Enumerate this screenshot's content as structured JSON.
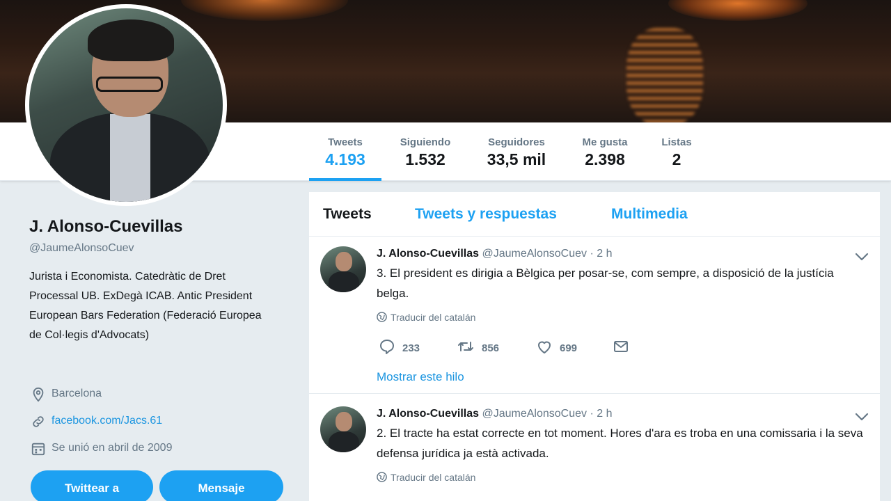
{
  "colors": {
    "accent": "#1da1f2",
    "link": "#1b95e0",
    "text": "#14171a",
    "muted": "#657786",
    "background": "#e6ecf0"
  },
  "stats": [
    {
      "label": "Tweets",
      "value": "4.193"
    },
    {
      "label": "Siguiendo",
      "value": "1.532"
    },
    {
      "label": "Seguidores",
      "value": "33,5 mil"
    },
    {
      "label": "Me gusta",
      "value": "2.398"
    },
    {
      "label": "Listas",
      "value": "2"
    }
  ],
  "profile": {
    "name": "J. Alonso-Cuevillas",
    "handle": "@JaumeAlonsoCuev",
    "bio": "Jurista i Economista. Catedràtic de Dret Processal UB. ExDegà ICAB. Antic President European Bars Federation (Federació Europea de Col·legis d'Advocats)",
    "location": "Barcelona",
    "location_icon": "location-pin-icon",
    "website": "facebook.com/Jacs.61",
    "website_icon": "link-icon",
    "joined": "Se unió en abril de 2009",
    "joined_icon": "calendar-icon",
    "tweet_to_button": "Twittear a",
    "message_button": "Mensaje"
  },
  "tabs": [
    {
      "label": "Tweets"
    },
    {
      "label": "Tweets y respuestas"
    },
    {
      "label": "Multimedia"
    }
  ],
  "tweets": [
    {
      "name": "J. Alonso-Cuevillas",
      "handle": "@JaumeAlonsoCuev",
      "dot": "·",
      "time": "2 h",
      "text": "3. El president es dirigia a Bèlgica per posar-se, com sempre, a disposició de la justícia belga.",
      "translate": "Traducir del catalán",
      "replies": "233",
      "retweets": "856",
      "likes": "699",
      "thread": "Mostrar este hilo"
    },
    {
      "name": "J. Alonso-Cuevillas",
      "handle": "@JaumeAlonsoCuev",
      "dot": "·",
      "time": "2 h",
      "text": "2. El tracte ha estat correcte en tot moment. Hores d'ara es troba en una comissaria i la seva defensa jurídica ja està activada.",
      "translate": "Traducir del catalán"
    }
  ]
}
